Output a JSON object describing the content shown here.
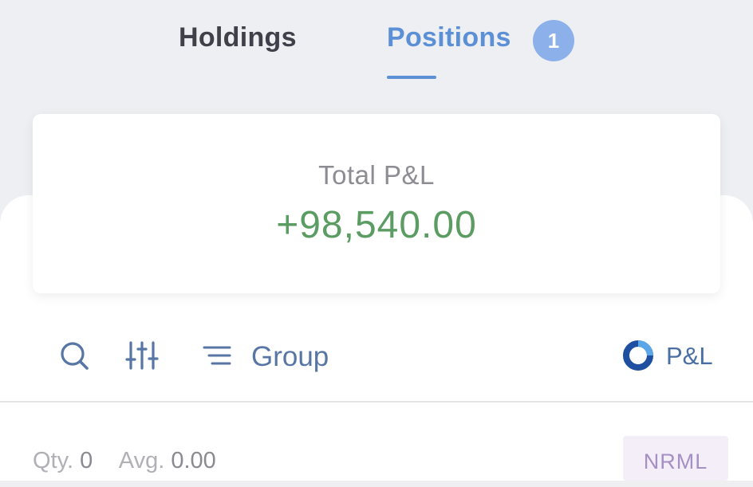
{
  "tabs": [
    {
      "label": "Holdings",
      "active": false
    },
    {
      "label": "Positions",
      "active": true,
      "badge": "1"
    }
  ],
  "pnl_card": {
    "label": "Total P&L",
    "value": "+98,540.00",
    "value_color": "#5a9c62"
  },
  "toolbar": {
    "icons": [
      "search-icon",
      "filter-sliders-icon",
      "group-list-icon",
      "pnl-toggle-icon"
    ],
    "group_label": "Group",
    "pnl_toggle_label": "P&L"
  },
  "positions": [
    {
      "qty_label": "Qty.",
      "qty": "0",
      "avg_label": "Avg.",
      "avg": "0.00",
      "product": "NRML"
    }
  ],
  "colors": {
    "accent": "#5b8fd6",
    "badge": "#8bb0ea",
    "profit": "#5a9c62",
    "icon": "#5876a4"
  }
}
